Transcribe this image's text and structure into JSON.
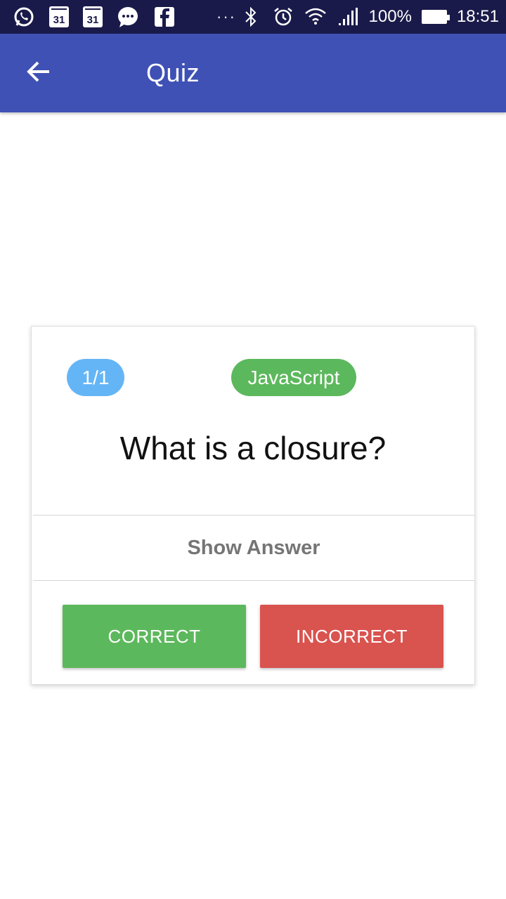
{
  "status_bar": {
    "calendar_day_1": "31",
    "calendar_day_2": "31",
    "overflow": "···",
    "battery": "100%",
    "time": "18:51",
    "icons": [
      "whatsapp-icon",
      "calendar-icon",
      "calendar-icon",
      "messenger-icon",
      "facebook-icon",
      "bluetooth-icon",
      "alarm-icon",
      "wifi-icon",
      "signal-icon",
      "battery-icon"
    ]
  },
  "app_bar": {
    "title": "Quiz",
    "background": "#3f51b5"
  },
  "card": {
    "progress": "1/1",
    "topic": "JavaScript",
    "question": "What is a closure?",
    "show_answer": "Show Answer",
    "correct_label": "CORRECT",
    "incorrect_label": "INCORRECT"
  },
  "colors": {
    "progress_badge": "#64b5f6",
    "topic_badge": "#5cb85c",
    "correct": "#5cb85c",
    "incorrect": "#d9534f"
  }
}
